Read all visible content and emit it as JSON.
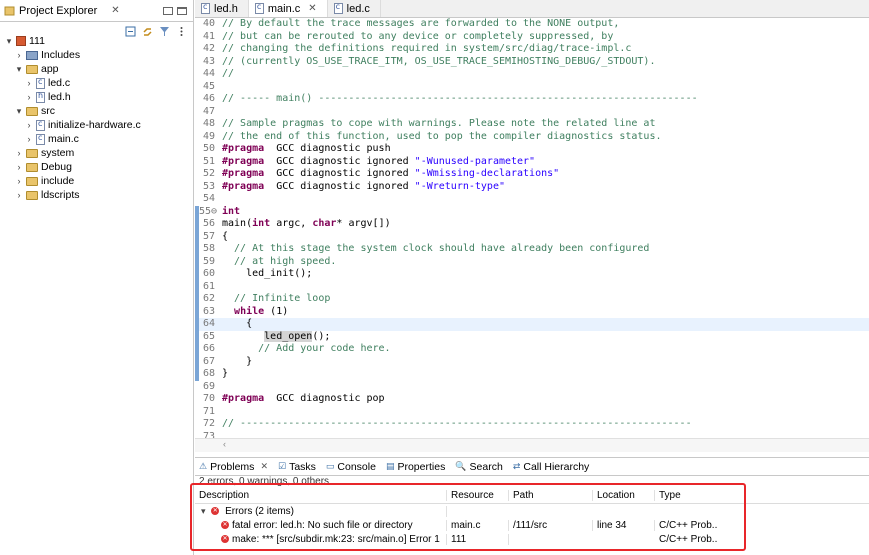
{
  "explorer": {
    "tab_label": "Project Explorer",
    "tree": [
      {
        "indent": 0,
        "caret": "▾",
        "icon": "proj",
        "label": "111"
      },
      {
        "indent": 1,
        "caret": "›",
        "icon": "lib",
        "label": "Includes"
      },
      {
        "indent": 1,
        "caret": "▾",
        "icon": "folder",
        "label": "app"
      },
      {
        "indent": 2,
        "caret": "›",
        "icon": "file",
        "label": "led.c"
      },
      {
        "indent": 2,
        "caret": "›",
        "icon": "file h",
        "label": "led.h"
      },
      {
        "indent": 1,
        "caret": "▾",
        "icon": "folder",
        "label": "src"
      },
      {
        "indent": 2,
        "caret": "›",
        "icon": "file",
        "label": "initialize-hardware.c"
      },
      {
        "indent": 2,
        "caret": "›",
        "icon": "file",
        "label": "main.c"
      },
      {
        "indent": 1,
        "caret": "›",
        "icon": "folder",
        "label": "system"
      },
      {
        "indent": 1,
        "caret": "›",
        "icon": "folder",
        "label": "Debug"
      },
      {
        "indent": 1,
        "caret": "›",
        "icon": "folder",
        "label": "include"
      },
      {
        "indent": 1,
        "caret": "›",
        "icon": "folder",
        "label": "ldscripts"
      }
    ]
  },
  "editor": {
    "tabs": [
      {
        "label": "led.h",
        "active": false,
        "close": ""
      },
      {
        "label": "main.c",
        "active": true,
        "close": "✕"
      },
      {
        "label": "led.c",
        "active": false,
        "close": ""
      }
    ],
    "lines": [
      {
        "n": "40",
        "hl": false,
        "cur": false,
        "text": "// By default the trace messages are forwarded to the NONE output,",
        "cls": "cm"
      },
      {
        "n": "41",
        "hl": false,
        "cur": false,
        "text": "// but can be rerouted to any device or completely suppressed, by",
        "cls": "cm"
      },
      {
        "n": "42",
        "hl": false,
        "cur": false,
        "text": "// changing the definitions required in system/src/diag/trace-impl.c",
        "cls": "cm"
      },
      {
        "n": "43",
        "hl": false,
        "cur": false,
        "text": "// (currently OS_USE_TRACE_ITM, OS_USE_TRACE_SEMIHOSTING_DEBUG/_STDOUT).",
        "cls": "cm"
      },
      {
        "n": "44",
        "hl": false,
        "cur": false,
        "text": "//",
        "cls": "cm"
      },
      {
        "n": "45",
        "hl": false,
        "cur": false,
        "text": "",
        "cls": ""
      },
      {
        "n": "46",
        "hl": false,
        "cur": false,
        "text": "// ----- main() ---------------------------------------------------------------",
        "cls": "cm"
      },
      {
        "n": "47",
        "hl": false,
        "cur": false,
        "text": "",
        "cls": ""
      },
      {
        "n": "48",
        "hl": false,
        "cur": false,
        "text": "// Sample pragmas to cope with warnings. Please note the related line at",
        "cls": "cm"
      },
      {
        "n": "49",
        "hl": false,
        "cur": false,
        "text": "// the end of this function, used to pop the compiler diagnostics status.",
        "cls": "cm"
      },
      {
        "n": "50",
        "hl": false,
        "cur": false,
        "text": "",
        "cls": "",
        "parts": [
          [
            "kw",
            "#pragma"
          ],
          [
            "",
            "  GCC diagnostic push"
          ]
        ]
      },
      {
        "n": "51",
        "hl": false,
        "cur": false,
        "text": "",
        "cls": "",
        "parts": [
          [
            "kw",
            "#pragma"
          ],
          [
            "",
            "  GCC diagnostic ignored "
          ],
          [
            "str",
            "\"-Wunused-parameter\""
          ]
        ]
      },
      {
        "n": "52",
        "hl": false,
        "cur": false,
        "text": "",
        "cls": "",
        "parts": [
          [
            "kw",
            "#pragma"
          ],
          [
            "",
            "  GCC diagnostic ignored "
          ],
          [
            "str",
            "\"-Wmissing-declarations\""
          ]
        ]
      },
      {
        "n": "53",
        "hl": false,
        "cur": false,
        "text": "",
        "cls": "",
        "parts": [
          [
            "kw",
            "#pragma"
          ],
          [
            "",
            "  GCC diagnostic ignored "
          ],
          [
            "str",
            "\"-Wreturn-type\""
          ]
        ]
      },
      {
        "n": "54",
        "hl": false,
        "cur": false,
        "text": "",
        "cls": ""
      },
      {
        "n": "55⊖",
        "hl": true,
        "cur": false,
        "text": "",
        "cls": "",
        "parts": [
          [
            "kw",
            "int"
          ]
        ]
      },
      {
        "n": "56",
        "hl": true,
        "cur": false,
        "text": "",
        "cls": "",
        "parts": [
          [
            "",
            "main("
          ],
          [
            "kw",
            "int"
          ],
          [
            "",
            " argc, "
          ],
          [
            "kw",
            "char"
          ],
          [
            "",
            "* argv[])"
          ]
        ]
      },
      {
        "n": "57",
        "hl": true,
        "cur": false,
        "text": "{",
        "cls": ""
      },
      {
        "n": "58",
        "hl": true,
        "cur": false,
        "text": "  // At this stage the system clock should have already been configured",
        "cls": "cm"
      },
      {
        "n": "59",
        "hl": true,
        "cur": false,
        "text": "  // at high speed.",
        "cls": "cm"
      },
      {
        "n": "60",
        "hl": true,
        "cur": false,
        "text": "    led_init();",
        "cls": ""
      },
      {
        "n": "61",
        "hl": true,
        "cur": false,
        "text": "",
        "cls": ""
      },
      {
        "n": "62",
        "hl": true,
        "cur": false,
        "text": "  // Infinite loop",
        "cls": "cm"
      },
      {
        "n": "63",
        "hl": true,
        "cur": false,
        "text": "",
        "cls": "",
        "parts": [
          [
            "",
            "  "
          ],
          [
            "kw",
            "while"
          ],
          [
            "",
            " (1)"
          ]
        ]
      },
      {
        "n": "64",
        "hl": true,
        "cur": true,
        "text": "    {",
        "cls": ""
      },
      {
        "n": "65",
        "hl": true,
        "cur": false,
        "text": "",
        "cls": "",
        "parts": [
          [
            "",
            "       "
          ],
          [
            "sel",
            "led_open"
          ],
          [
            "",
            "();"
          ]
        ]
      },
      {
        "n": "66",
        "hl": true,
        "cur": false,
        "text": "      // Add your code here.",
        "cls": "cm"
      },
      {
        "n": "67",
        "hl": true,
        "cur": false,
        "text": "    }",
        "cls": ""
      },
      {
        "n": "68",
        "hl": true,
        "cur": false,
        "text": "}",
        "cls": ""
      },
      {
        "n": "69",
        "hl": false,
        "cur": false,
        "text": "",
        "cls": ""
      },
      {
        "n": "70",
        "hl": false,
        "cur": false,
        "text": "",
        "cls": "",
        "parts": [
          [
            "kw",
            "#pragma"
          ],
          [
            "",
            "  GCC diagnostic pop"
          ]
        ]
      },
      {
        "n": "71",
        "hl": false,
        "cur": false,
        "text": "",
        "cls": ""
      },
      {
        "n": "72",
        "hl": false,
        "cur": false,
        "text": "// ---------------------------------------------------------------------------",
        "cls": "cm"
      },
      {
        "n": "73",
        "hl": false,
        "cur": false,
        "text": "",
        "cls": ""
      }
    ]
  },
  "problems": {
    "tabs": [
      "Problems",
      "Tasks",
      "Console",
      "Properties",
      "Search",
      "Call Hierarchy"
    ],
    "summary": "2 errors, 0 warnings, 0 others",
    "columns": [
      "Description",
      "Resource",
      "Path",
      "Location",
      "Type"
    ],
    "group_label": "Errors (2 items)",
    "rows": [
      {
        "desc": "fatal error: led.h: No such file or directory",
        "resource": "main.c",
        "path": "/111/src",
        "location": "line 34",
        "type": "C/C++ Prob..."
      },
      {
        "desc": "make: *** [src/subdir.mk:23: src/main.o] Error 1",
        "resource": "111",
        "path": "",
        "location": "",
        "type": "C/C++ Prob..."
      }
    ]
  },
  "colors": {
    "accent_box": "#e8262a",
    "hl_bar": "#7aa5d6"
  }
}
